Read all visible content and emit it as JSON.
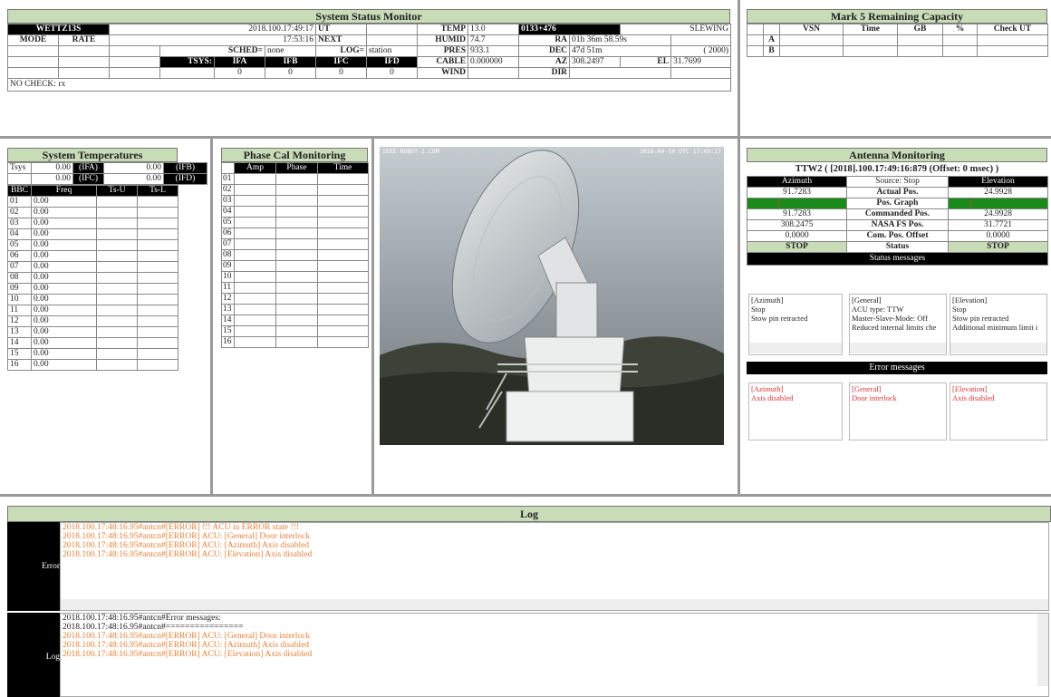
{
  "ssm": {
    "title": "System Status Monitor",
    "station": "WETTZ13S",
    "date": "2018.100.17:49:17",
    "ut": "UT",
    "temp_l": "TEMP",
    "temp": "13.0",
    "src": "0133+476",
    "slew": "SLEWING",
    "mode": "MODE",
    "rate": "RATE",
    "time": "17:53:16",
    "next": "NEXT",
    "humid_l": "HUMID",
    "humid": "74.7",
    "ra_l": "RA",
    "ra": "01h 36m 58.59s",
    "sched_l": "SCHED=",
    "sched": "none",
    "log_l": "LOG=",
    "log": "station",
    "pres_l": "PRES",
    "pres": "933.1",
    "dec_l": "DEC",
    "dec": "47d 51m",
    "epoch": "( 2000)",
    "tsys": "TSYS:",
    "ifa": "IFA",
    "ifb": "IFB",
    "ifc": "IFC",
    "ifd": "IFD",
    "cable_l": "CABLE",
    "cable": "0.000000",
    "az_l": "AZ",
    "az": "308.2497",
    "el_l": "EL",
    "el": "31.7699",
    "z1": "0",
    "z2": "0",
    "z3": "0",
    "z4": "0",
    "wind_l": "WIND",
    "dir_l": "DIR",
    "nocheck": "NO CHECK: rx"
  },
  "mk5": {
    "title": "Mark 5 Remaining Capacity",
    "h_vsn": "VSN",
    "h_time": "Time",
    "h_gb": "GB",
    "h_pct": "%",
    "h_check": "Check UT",
    "a": "A",
    "b": "B"
  },
  "st": {
    "title": "System Temperatures",
    "tsys": "Tsys",
    "v": "0.00",
    "ifa": "(IFA)",
    "ifb": "(IFB)",
    "ifc": "(IFC)",
    "ifd": "(IFD)",
    "bbc": "BBC",
    "freq": "Freq",
    "tsu": "Ts-U",
    "tsl": "Ts-L",
    "rows": [
      "01",
      "02",
      "03",
      "04",
      "05",
      "06",
      "07",
      "08",
      "09",
      "10",
      "11",
      "12",
      "13",
      "14",
      "15",
      "16"
    ],
    "val": "0.00"
  },
  "pc": {
    "title": "Phase Cal Monitoring",
    "amp": "Amp",
    "phase": "Phase",
    "time": "Time",
    "rows": [
      "01",
      "02",
      "03",
      "04",
      "05",
      "06",
      "07",
      "08",
      "09",
      "10",
      "11",
      "12",
      "13",
      "14",
      "15",
      "16"
    ]
  },
  "cam": {
    "left_label": "IEEE-ROBOT-I.COM",
    "right_label": "2018-04-10 UTC 17:49:17"
  },
  "am": {
    "title": "Antenna Monitoring",
    "sub": "TTW2 ( [2018].100.17:49:16:879 (Offset: 0 msec) )",
    "h_az": "Azimuth",
    "h_src": "Source: Stop",
    "h_el": "Elevation",
    "act_az": "91.7283",
    "act_l": "Actual Pos.",
    "act_el": "24.9928",
    "graph_l": "Pos. Graph",
    "cmd_az": "91.7283",
    "cmd_l": "Commanded Pos.",
    "cmd_el": "24.9928",
    "fs_az": "308.2475",
    "fs_l": "NASA FS Pos.",
    "fs_el": "31.7721",
    "off_az": "0.0000",
    "off_l": "Com. Pos. Offset",
    "off_el": "0.0000",
    "stop_az": "STOP",
    "status_l": "Status",
    "stop_el": "STOP",
    "statmsg": "Status messages",
    "errmsg": "Error messages",
    "s1": [
      "[Azimuth]",
      "Stop",
      "Stow pin retracted"
    ],
    "s2": [
      "[General]",
      "ACU type: TTW",
      "Master-Slave-Mode: Off",
      "Reduced internal limits che"
    ],
    "s3": [
      "[Elevation]",
      "Stop",
      "Stow pin retracted",
      "Additional minimum limit i"
    ],
    "e1": [
      "[Azimuth]",
      "Axis disabled"
    ],
    "e2": [
      "[General]",
      "Door interlock"
    ],
    "e3": [
      "[Elevation]",
      "Axis disabled"
    ]
  },
  "log": {
    "title": "Log",
    "error_tab": "Error",
    "log_tab": "Log",
    "err": [
      "2018.100.17:48:16.95#antcn#[ERROR] !!! ACU in ERROR state !!!",
      "2018.100.17:48:16.95#antcn#[ERROR] ACU: [General] Door interlock",
      "2018.100.17:48:16.95#antcn#[ERROR] ACU: [Azimuth] Axis disabled",
      "2018.100.17:48:16.95#antcn#[ERROR] ACU: [Elevation] Axis disabled"
    ],
    "l1": "2018.100.17:48:16.95#antcn#Error messages:",
    "l2": "2018.100.17:48:16.95#antcn#================",
    "lo": [
      "2018.100.17:48:16.95#antcn#[ERROR] ACU: [General] Door interlock",
      "2018.100.17:48:16.95#antcn#[ERROR] ACU: [Azimuth] Axis disabled",
      "2018.100.17:48:16.95#antcn#[ERROR] ACU: [Elevation] Axis disabled"
    ]
  }
}
